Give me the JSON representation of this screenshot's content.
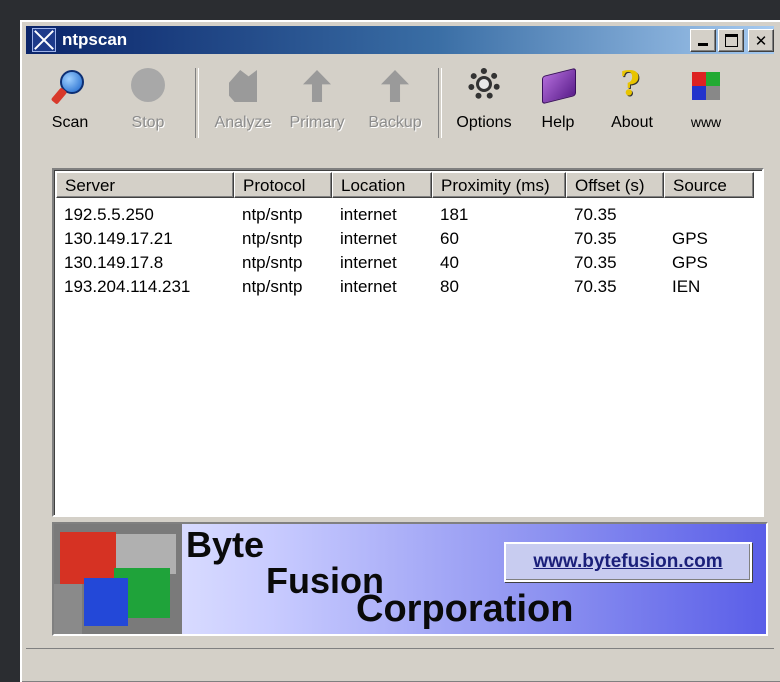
{
  "window": {
    "title": "ntpscan"
  },
  "toolbar": {
    "scan": "Scan",
    "stop": "Stop",
    "analyze": "Analyze",
    "primary": "Primary",
    "backup": "Backup",
    "options": "Options",
    "help": "Help",
    "about": "About",
    "www": "www"
  },
  "table": {
    "headers": [
      "Server",
      "Protocol",
      "Location",
      "Proximity (ms)",
      "Offset (s)",
      "Source"
    ],
    "rows": [
      [
        "192.5.5.250",
        "ntp/sntp",
        "internet",
        "181",
        "70.35",
        ""
      ],
      [
        "130.149.17.21",
        "ntp/sntp",
        "internet",
        "60",
        "70.35",
        "GPS"
      ],
      [
        "130.149.17.8",
        "ntp/sntp",
        "internet",
        "40",
        "70.35",
        "GPS"
      ],
      [
        "193.204.114.231",
        "ntp/sntp",
        "internet",
        "80",
        "70.35",
        "IEN"
      ]
    ]
  },
  "banner": {
    "word1": "Byte",
    "word2": "Fusion",
    "word3": "Corporation",
    "url": "www.bytefusion.com"
  },
  "colors": {
    "titlebar_start": "#0a246a",
    "titlebar_end": "#a6caf0",
    "face": "#d4d0c8",
    "banner_blue": "#5a5ee8"
  }
}
